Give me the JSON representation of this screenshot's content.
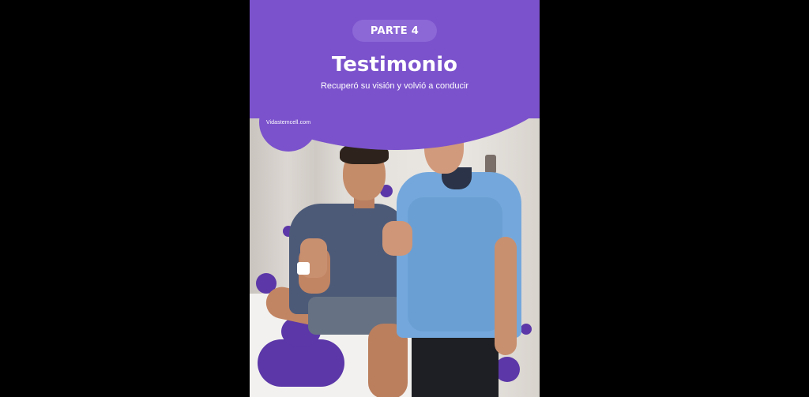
{
  "story": {
    "part_label": "PARTE 4",
    "title": "Testimonio",
    "subtitle": "Recuperó su visión y volvió a conducir",
    "site": "Vidastemcell.com"
  },
  "colors": {
    "background": "#000000",
    "brand_purple": "#7b52cc",
    "pill_purple": "#8c67d6",
    "dark_purple": "#5b37a8",
    "text": "#ffffff"
  }
}
